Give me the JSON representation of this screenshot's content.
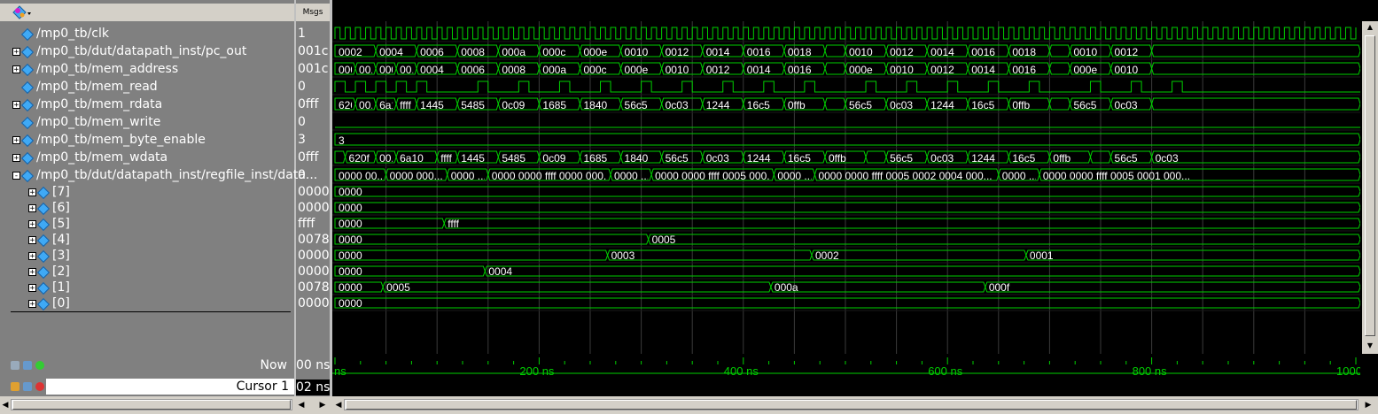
{
  "header": {
    "msgs_label": "Msgs"
  },
  "signals": [
    {
      "name": "/mp0_tb/clk",
      "msg": "1",
      "expand": "",
      "indent": 0
    },
    {
      "name": "/mp0_tb/dut/datapath_inst/pc_out",
      "msg": "001c",
      "expand": "+",
      "indent": 0
    },
    {
      "name": "/mp0_tb/mem_address",
      "msg": "001c",
      "expand": "+",
      "indent": 0
    },
    {
      "name": "/mp0_tb/mem_read",
      "msg": "0",
      "expand": "",
      "indent": 0
    },
    {
      "name": "/mp0_tb/mem_rdata",
      "msg": "0fff",
      "expand": "+",
      "indent": 0
    },
    {
      "name": "/mp0_tb/mem_write",
      "msg": "0",
      "expand": "",
      "indent": 0
    },
    {
      "name": "/mp0_tb/mem_byte_enable",
      "msg": "3",
      "expand": "+",
      "indent": 0
    },
    {
      "name": "/mp0_tb/mem_wdata",
      "msg": "0fff",
      "expand": "+",
      "indent": 0
    },
    {
      "name": "/mp0_tb/dut/datapath_inst/regfile_inst/data",
      "msg": "0...",
      "expand": "-",
      "indent": 0
    },
    {
      "name": "[7]",
      "msg": "0000",
      "expand": "+",
      "indent": 1
    },
    {
      "name": "[6]",
      "msg": "0000",
      "expand": "+",
      "indent": 1
    },
    {
      "name": "[5]",
      "msg": "ffff",
      "expand": "+",
      "indent": 1
    },
    {
      "name": "[4]",
      "msg": "0078",
      "expand": "+",
      "indent": 1
    },
    {
      "name": "[3]",
      "msg": "0000",
      "expand": "+",
      "indent": 1
    },
    {
      "name": "[2]",
      "msg": "0000",
      "expand": "+",
      "indent": 1
    },
    {
      "name": "[1]",
      "msg": "0078",
      "expand": "+",
      "indent": 1
    },
    {
      "name": "[0]",
      "msg": "0000",
      "expand": "+",
      "indent": 1
    }
  ],
  "waves": {
    "pc_out": [
      [
        0,
        "0002"
      ],
      [
        40,
        "0004"
      ],
      [
        80,
        "0006"
      ],
      [
        120,
        "0008"
      ],
      [
        160,
        "000a"
      ],
      [
        200,
        "000c"
      ],
      [
        240,
        "000e"
      ],
      [
        280,
        "0010"
      ],
      [
        320,
        "0012"
      ],
      [
        360,
        "0014"
      ],
      [
        400,
        "0016"
      ],
      [
        440,
        "0018"
      ],
      [
        480,
        ""
      ],
      [
        500,
        "0010"
      ],
      [
        540,
        "0012"
      ],
      [
        580,
        "0014"
      ],
      [
        620,
        "0016"
      ],
      [
        660,
        "0018"
      ],
      [
        700,
        ""
      ],
      [
        720,
        "0010"
      ],
      [
        760,
        "0012"
      ],
      [
        800,
        ""
      ]
    ],
    "mem_address": [
      [
        0,
        "0000"
      ],
      [
        20,
        "00..."
      ],
      [
        40,
        "0002"
      ],
      [
        60,
        "00..."
      ],
      [
        80,
        "0004"
      ],
      [
        120,
        "0006"
      ],
      [
        160,
        "0008"
      ],
      [
        200,
        "000a"
      ],
      [
        240,
        "000c"
      ],
      [
        280,
        "000e"
      ],
      [
        320,
        "0010"
      ],
      [
        360,
        "0012"
      ],
      [
        400,
        "0014"
      ],
      [
        440,
        "0016"
      ],
      [
        480,
        ""
      ],
      [
        500,
        "000e"
      ],
      [
        540,
        "0010"
      ],
      [
        580,
        "0012"
      ],
      [
        620,
        "0014"
      ],
      [
        660,
        "0016"
      ],
      [
        700,
        ""
      ],
      [
        720,
        "000e"
      ],
      [
        760,
        "0010"
      ],
      [
        800,
        ""
      ]
    ],
    "mem_read_edges": [
      0,
      20,
      40,
      60,
      80,
      140,
      180,
      220,
      260,
      300,
      340,
      380,
      420,
      460,
      520,
      560,
      600,
      640,
      680,
      740,
      780,
      820
    ],
    "mem_rdata": [
      [
        0,
        "620f"
      ],
      [
        20,
        "00..."
      ],
      [
        40,
        "6a10"
      ],
      [
        60,
        "ffff"
      ],
      [
        80,
        "1445"
      ],
      [
        120,
        "5485"
      ],
      [
        160,
        "0c09"
      ],
      [
        200,
        "1685"
      ],
      [
        240,
        "1840"
      ],
      [
        280,
        "56c5"
      ],
      [
        320,
        "0c03"
      ],
      [
        360,
        "1244"
      ],
      [
        400,
        "16c5"
      ],
      [
        440,
        "0ffb"
      ],
      [
        480,
        ""
      ],
      [
        500,
        "56c5"
      ],
      [
        540,
        "0c03"
      ],
      [
        580,
        "1244"
      ],
      [
        620,
        "16c5"
      ],
      [
        660,
        "0ffb"
      ],
      [
        700,
        ""
      ],
      [
        720,
        "56c5"
      ],
      [
        760,
        "0c03"
      ],
      [
        800,
        ""
      ]
    ],
    "mem_byte_enable": [
      [
        0,
        "3"
      ]
    ],
    "mem_wdata": [
      [
        0,
        ""
      ],
      [
        10,
        "620f"
      ],
      [
        40,
        "00..."
      ],
      [
        60,
        "6a10"
      ],
      [
        100,
        "ffff"
      ],
      [
        120,
        "1445"
      ],
      [
        160,
        "5485"
      ],
      [
        200,
        "0c09"
      ],
      [
        240,
        "1685"
      ],
      [
        280,
        "1840"
      ],
      [
        320,
        "56c5"
      ],
      [
        360,
        "0c03"
      ],
      [
        400,
        "1244"
      ],
      [
        440,
        "16c5"
      ],
      [
        480,
        "0ffb"
      ],
      [
        520,
        ""
      ],
      [
        540,
        "56c5"
      ],
      [
        580,
        "0c03"
      ],
      [
        620,
        "1244"
      ],
      [
        660,
        "16c5"
      ],
      [
        700,
        "0ffb"
      ],
      [
        740,
        ""
      ],
      [
        760,
        "56c5"
      ],
      [
        800,
        "0c03"
      ]
    ],
    "regfile_data": [
      [
        0,
        "0000 00..."
      ],
      [
        50,
        "0000 000..."
      ],
      [
        110,
        "0000 ..."
      ],
      [
        150,
        "0000 0000 ffff 0000 000..."
      ],
      [
        270,
        "0000 ..."
      ],
      [
        310,
        "0000 0000 ffff 0005 000..."
      ],
      [
        430,
        "0000 ..."
      ],
      [
        470,
        "0000 0000 ffff 0005 0002 0004 000..."
      ],
      [
        650,
        "0000 ..."
      ],
      [
        690,
        "0000 0000 ffff 0005 0001 000..."
      ]
    ],
    "reg7": [
      [
        0,
        "0000"
      ]
    ],
    "reg6": [
      [
        0,
        "0000"
      ]
    ],
    "reg5": [
      [
        0,
        "0000"
      ],
      [
        107,
        "ffff"
      ]
    ],
    "reg4": [
      [
        0,
        "0000"
      ],
      [
        307,
        "0005"
      ]
    ],
    "reg3": [
      [
        0,
        "0000"
      ],
      [
        267,
        "0003"
      ],
      [
        467,
        "0002"
      ],
      [
        677,
        "0001"
      ]
    ],
    "reg2": [
      [
        0,
        "0000"
      ],
      [
        147,
        "0004"
      ]
    ],
    "reg1": [
      [
        0,
        "0000"
      ],
      [
        47,
        "0005"
      ],
      [
        427,
        "000a"
      ],
      [
        637,
        "000f"
      ]
    ],
    "reg0": [
      [
        0,
        "0000"
      ]
    ]
  },
  "timeline": {
    "now_label": "Now",
    "now_value": "00 ns",
    "cursor_label": "Cursor 1",
    "cursor_value": "02 ns",
    "ticks": [
      "ns",
      "200 ns",
      "400 ns",
      "600 ns",
      "800 ns",
      "1000 ns"
    ]
  },
  "colors": {
    "wave": "#00d000",
    "text_wave": "#ffffff",
    "grid": "#3a3a3a"
  }
}
